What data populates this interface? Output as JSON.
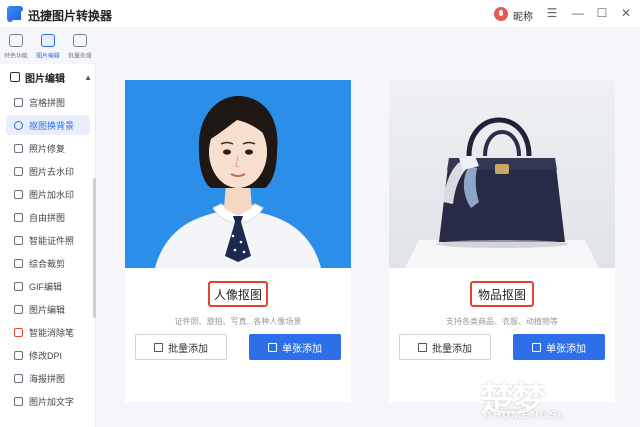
{
  "app": {
    "title": "迅捷图片转换器"
  },
  "user": {
    "name": "昵称"
  },
  "top_tabs": [
    {
      "label": "特色功能",
      "icon": "feature-icon"
    },
    {
      "label": "图片编辑",
      "icon": "image-edit-icon"
    },
    {
      "label": "批量处理",
      "icon": "batch-icon"
    }
  ],
  "sidebar": {
    "header": "图片编辑",
    "items": [
      {
        "label": "宫格拼图"
      },
      {
        "label": "抠图换背景"
      },
      {
        "label": "照片修复"
      },
      {
        "label": "图片去水印"
      },
      {
        "label": "图片加水印"
      },
      {
        "label": "自由拼图"
      },
      {
        "label": "智能证件照"
      },
      {
        "label": "综合裁剪"
      },
      {
        "label": "GIF编辑"
      },
      {
        "label": "图片编辑"
      },
      {
        "label": "智能消除笔"
      },
      {
        "label": "修改DPI"
      },
      {
        "label": "海报拼图"
      },
      {
        "label": "图片加文字"
      }
    ],
    "active_index": 1
  },
  "cards": {
    "portrait": {
      "title": "人像抠图",
      "desc": "证件照、旅拍、写真...各种人像场景",
      "batch_label": "批量添加",
      "single_label": "单张添加"
    },
    "object": {
      "title": "物品抠图",
      "desc": "支持各类商品、衣服、动植物等",
      "batch_label": "批量添加",
      "single_label": "单张添加"
    }
  },
  "watermark": {
    "logo": "楚梦",
    "text": "CHUMENGSI"
  },
  "colors": {
    "accent": "#2d6fe8",
    "highlight": "#e0452f",
    "photo_bg": "#2b8fea"
  }
}
